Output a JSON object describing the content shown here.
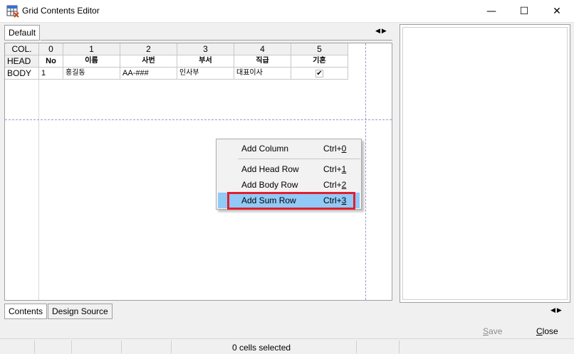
{
  "window": {
    "title": "Grid Contents Editor",
    "min_glyph": "—",
    "max_glyph": "☐",
    "close_glyph": "✕"
  },
  "tabs_top": [
    {
      "label": "Default"
    }
  ],
  "tab_arrows": "◀▶",
  "grid": {
    "col_label": "COL.",
    "columns": [
      "0",
      "1",
      "2",
      "3",
      "4",
      "5"
    ],
    "head_label": "HEAD",
    "head": [
      "No",
      "이름",
      "사번",
      "부서",
      "직급",
      "기혼"
    ],
    "body_label": "BODY",
    "body": [
      "1",
      "홍길동",
      "AA-###",
      "인사부",
      "대표이사",
      "✔"
    ]
  },
  "context_menu": {
    "items": [
      {
        "label": "Add Column",
        "shortcut": "Ctrl+0"
      },
      {
        "label": "Add Head Row",
        "shortcut": "Ctrl+1"
      },
      {
        "label": "Add Body Row",
        "shortcut": "Ctrl+2"
      },
      {
        "label": "Add Sum Row",
        "shortcut": "Ctrl+3"
      }
    ],
    "highlighted_index": 3
  },
  "tabs_bottom": [
    {
      "label": "Contents"
    },
    {
      "label": "Design Source"
    }
  ],
  "footer": {
    "save_label": "Save",
    "close_label": "Close"
  },
  "status": {
    "text": "0 cells selected"
  },
  "colors": {
    "highlight": "#91c9f7",
    "annotation_box": "#e0202e"
  }
}
